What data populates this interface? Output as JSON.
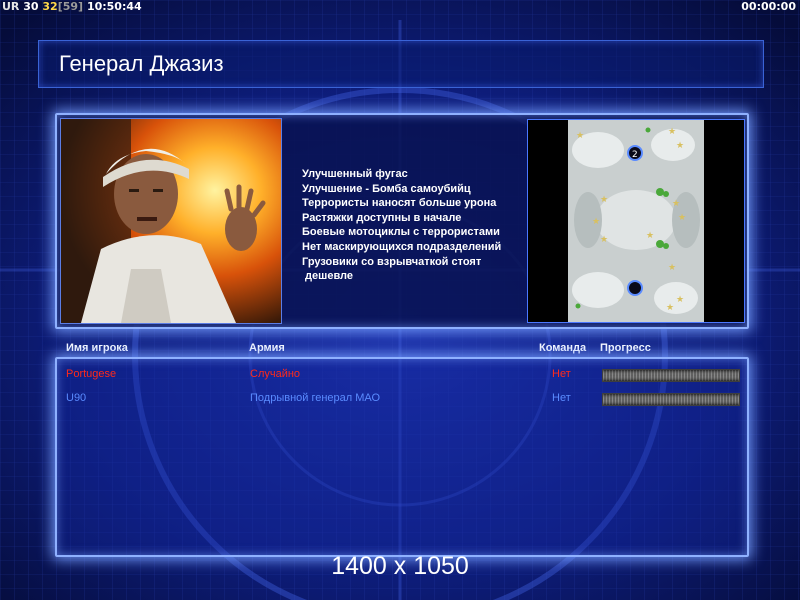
{
  "hud": {
    "ur_label": "UR",
    "fps": "30",
    "fps_current": "32",
    "fps_cap": "[59]",
    "clock": "10:50:44",
    "game_timer": "00:00:00"
  },
  "screen_title": "Генерал Джазиз",
  "bonuses": [
    "Улучшенный фугас",
    "Улучшение - Бомба самоубийц",
    "Террористы наносят больше урона",
    "Растяжки доступны в начале",
    "Боевые мотоциклы с террористами",
    "Нет маскирующихся подразделений",
    "Грузовики со взрывчаткой стоят",
    " дешевле"
  ],
  "minimap": {
    "start_positions": [
      "2"
    ]
  },
  "table": {
    "headers": {
      "player_name": "Имя игрока",
      "army": "Армия",
      "team": "Команда",
      "progress": "Прогресс"
    },
    "rows": [
      {
        "name": "Portugese",
        "army": "Случайно",
        "team": "Нет",
        "color": "#ff2a1a"
      },
      {
        "name": "U90",
        "army": "Подрывной генерал МАО",
        "team": "Нет",
        "color": "#5a8bff"
      }
    ]
  },
  "resolution_text": "1400 x 1050",
  "colors": {
    "accent_border": "#8fb1ff",
    "background": "#07124a",
    "player_red": "#ff2a1a",
    "player_blue": "#5a8bff"
  }
}
